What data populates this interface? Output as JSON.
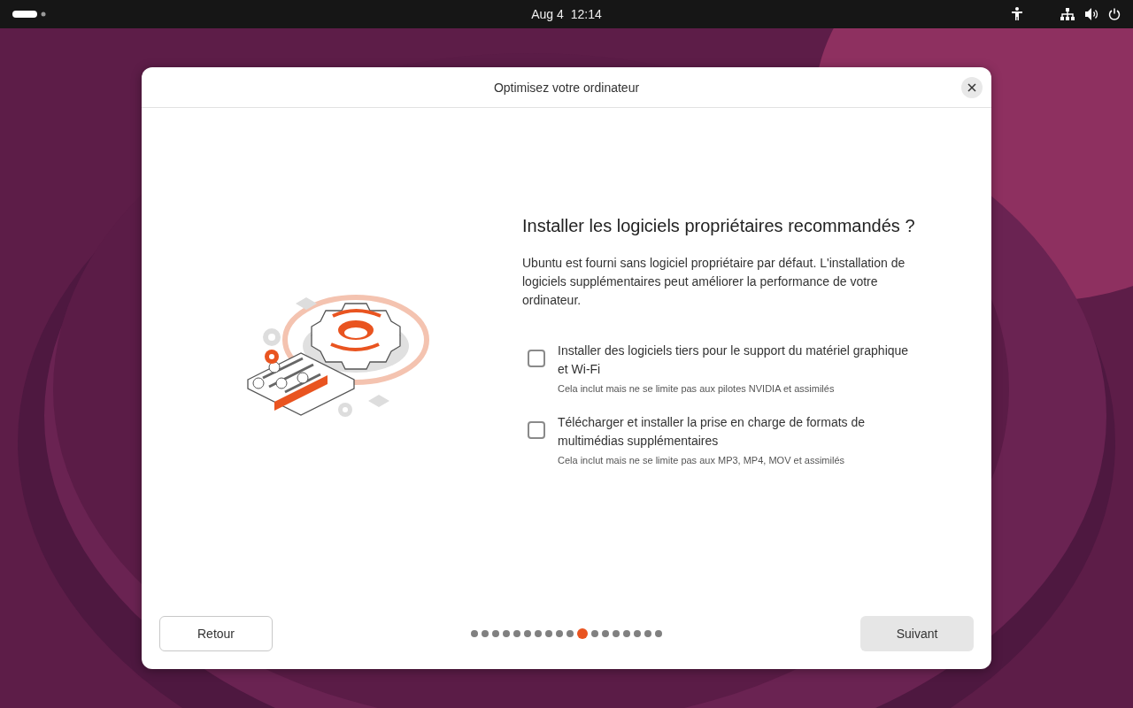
{
  "top_bar": {
    "date": "Aug 4",
    "time": "12:14"
  },
  "dialog": {
    "title": "Optimisez votre ordinateur",
    "heading": "Installer les logiciels propriétaires recommandés ?",
    "description": "Ubuntu est fourni sans logiciel propriétaire par défaut. L'installation de logiciels supplémentaires peut améliorer la performance de votre ordinateur.",
    "options": [
      {
        "label": "Installer des logiciels tiers pour le support du matériel graphique et Wi-Fi",
        "note": "Cela inclut mais ne se limite pas aux pilotes NVIDIA et assimilés",
        "checked": false
      },
      {
        "label": "Télécharger et installer la prise en charge de formats de multimédias supplémentaires",
        "note": "Cela inclut mais ne se limite pas aux MP3, MP4, MOV et assimilés",
        "checked": false
      }
    ],
    "back_button": "Retour",
    "next_button": "Suivant",
    "steps": [
      {
        "selected": false
      },
      {
        "selected": false
      },
      {
        "selected": false
      },
      {
        "selected": false
      },
      {
        "selected": false
      },
      {
        "selected": false
      },
      {
        "selected": false
      },
      {
        "selected": false
      },
      {
        "selected": false
      },
      {
        "selected": false
      },
      {
        "selected": true
      },
      {
        "selected": false
      },
      {
        "selected": false
      },
      {
        "selected": false
      },
      {
        "selected": false
      },
      {
        "selected": false
      },
      {
        "selected": false
      },
      {
        "selected": false
      }
    ]
  }
}
